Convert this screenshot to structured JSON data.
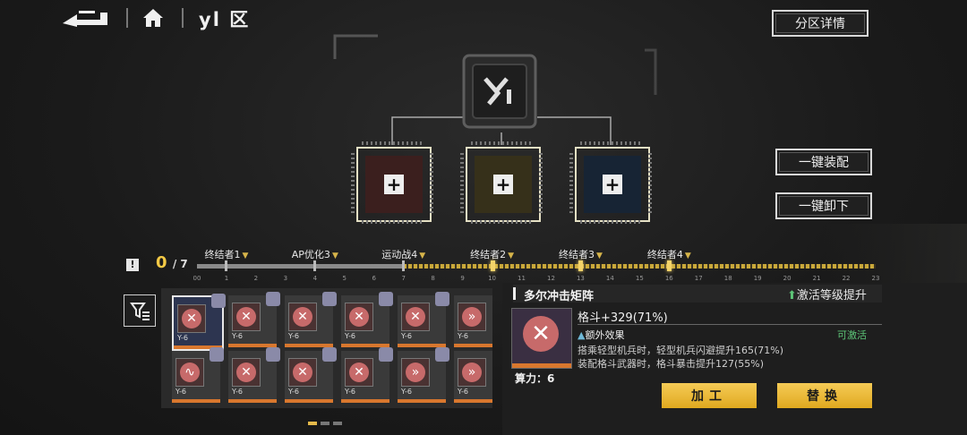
{
  "header": {
    "zone_title": "yl 区",
    "zone_details_label": "分区详情"
  },
  "side_buttons": {
    "equip_all_label": "一键装配",
    "unequip_all_label": "一键卸下"
  },
  "progress": {
    "current": "0",
    "total": "/ 7",
    "milestones": [
      {
        "label": "终结者1",
        "at": 1
      },
      {
        "label": "AP优化3",
        "at": 4
      },
      {
        "label": "运动战4",
        "at": 7
      },
      {
        "label": "终结者2",
        "at": 10
      },
      {
        "label": "终结者3",
        "at": 13
      },
      {
        "label": "终结者4",
        "at": 16
      }
    ],
    "scale": [
      "00",
      "1",
      "2",
      "3",
      "4",
      "5",
      "6",
      "7",
      "8",
      "9",
      "10",
      "11",
      "12",
      "13",
      "14",
      "15",
      "16",
      "17",
      "18",
      "19",
      "20",
      "21",
      "22",
      "23"
    ]
  },
  "chips": [
    {
      "name": "chip-slot-red",
      "color": "#3b1f1e"
    },
    {
      "name": "chip-slot-olive",
      "color": "#36301a"
    },
    {
      "name": "chip-slot-blue",
      "color": "#172434"
    }
  ],
  "inventory": {
    "cards": [
      {
        "level": "Y-6",
        "selected": true,
        "icon": "x-icon"
      },
      {
        "level": "Y-6",
        "icon": "x-icon"
      },
      {
        "level": "Y-6",
        "icon": "x-icon"
      },
      {
        "level": "Y-6",
        "icon": "x-icon"
      },
      {
        "level": "Y-6",
        "icon": "x-icon"
      },
      {
        "level": "Y-6",
        "icon": "arrows-icon"
      },
      {
        "level": "Y-6",
        "icon": "wave-icon"
      },
      {
        "level": "Y-6",
        "icon": "x-icon"
      },
      {
        "level": "Y-6",
        "icon": "x-icon"
      },
      {
        "level": "Y-6",
        "icon": "x-icon"
      },
      {
        "level": "Y-6",
        "icon": "arrows-icon"
      },
      {
        "level": "Y-6",
        "icon": "arrows-icon"
      }
    ]
  },
  "detail": {
    "title": "多尔冲击矩阵",
    "upgrade_label": "激活等级提升",
    "main_stat": "格斗+329(71%)",
    "extra_title": "额外效果",
    "activatable": "可激活",
    "desc1": "搭乘轻型机兵时，轻型机兵闪避提升165(71%)",
    "desc2": "装配格斗武器时，格斗暴击提升127(55%)",
    "power": "算力：6",
    "process_label": "加工",
    "replace_label": "替换"
  }
}
